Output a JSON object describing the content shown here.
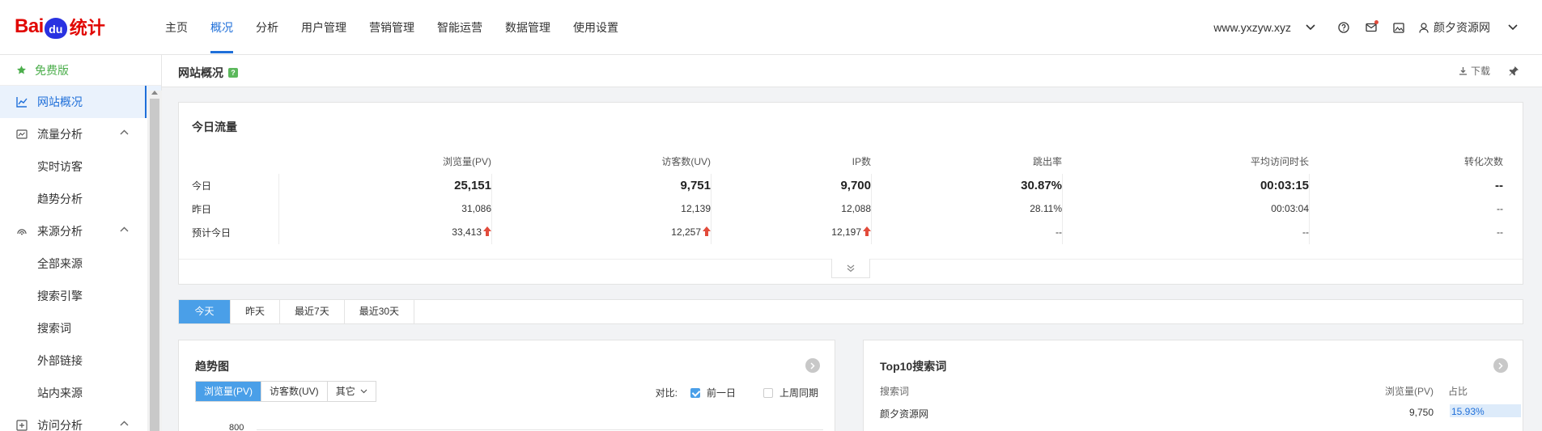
{
  "brand": {
    "logo_left": "Bai",
    "logo_paw": "du",
    "logo_right": "统计",
    "red": "#e10601",
    "blue": "#2932e1"
  },
  "nav": {
    "items": [
      "主页",
      "概况",
      "分析",
      "用户管理",
      "营销管理",
      "智能运营",
      "数据管理",
      "使用设置"
    ],
    "active_index": 1
  },
  "top_right": {
    "site": "www.yxzyw.xyz",
    "user": "颜夕资源网",
    "icons": [
      "help-icon",
      "message-icon",
      "image-icon",
      "user-icon"
    ]
  },
  "sidebar": {
    "free_label": "免费版",
    "items": [
      {
        "label": "网站概况",
        "icon": "line-chart-icon",
        "active": true
      },
      {
        "label": "流量分析",
        "icon": "traffic-icon",
        "expanded": true,
        "children": [
          "实时访客",
          "趋势分析"
        ]
      },
      {
        "label": "来源分析",
        "icon": "source-icon",
        "expanded": true,
        "children": [
          "全部来源",
          "搜索引擎",
          "搜索词",
          "外部链接",
          "站内来源"
        ]
      },
      {
        "label": "访问分析",
        "icon": "visit-icon",
        "expanded": true
      }
    ]
  },
  "page": {
    "title": "网站概况",
    "help_badge": "?",
    "download_label": "下载"
  },
  "today_traffic": {
    "title": "今日流量",
    "columns": [
      "浏览量(PV)",
      "访客数(UV)",
      "IP数",
      "跳出率",
      "平均访问时长",
      "转化次数"
    ],
    "rows": [
      {
        "label": "今日",
        "values": [
          "25,151",
          "9,751",
          "9,700",
          "30.87%",
          "00:03:15",
          "--"
        ],
        "bold": true
      },
      {
        "label": "昨日",
        "values": [
          "31,086",
          "12,139",
          "12,088",
          "28.11%",
          "00:03:04",
          "--"
        ]
      },
      {
        "label": "预计今日",
        "values": [
          "33,413",
          "12,257",
          "12,197",
          "--",
          "--",
          "--"
        ],
        "up_arrow": [
          true,
          true,
          true,
          false,
          false,
          false
        ]
      }
    ],
    "up_color": "#e24b3b"
  },
  "range_tabs": {
    "items": [
      "今天",
      "昨天",
      "最近7天",
      "最近30天"
    ],
    "active_index": 0
  },
  "trend": {
    "title": "趋势图",
    "metrics": [
      "浏览量(PV)",
      "访客数(UV)",
      "其它"
    ],
    "active_metric": 0,
    "compare_label": "对比:",
    "compare_options": [
      {
        "label": "前一日",
        "checked": true
      },
      {
        "label": "上周同期",
        "checked": false
      }
    ],
    "y_tick_top": "800"
  },
  "top10": {
    "title": "Top10搜索词",
    "headers": [
      "搜索词",
      "浏览量(PV)",
      "占比"
    ],
    "rows": [
      {
        "term": "颜夕资源网",
        "pv": "9,750",
        "share": "15.93%"
      }
    ]
  },
  "accent": "#1f6fd9"
}
